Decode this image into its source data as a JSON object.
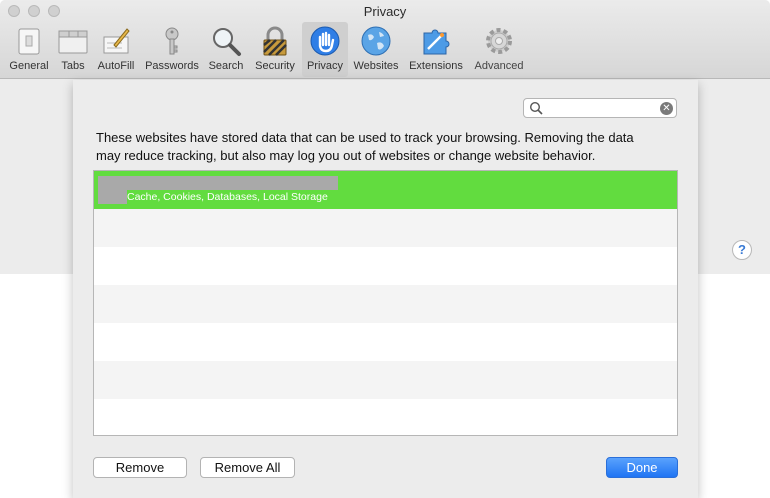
{
  "window": {
    "title": "Privacy"
  },
  "toolbar": {
    "items": [
      {
        "label": "General",
        "icon": "general-icon"
      },
      {
        "label": "Tabs",
        "icon": "tabs-icon"
      },
      {
        "label": "AutoFill",
        "icon": "autofill-icon"
      },
      {
        "label": "Passwords",
        "icon": "key-icon"
      },
      {
        "label": "Search",
        "icon": "search-icon"
      },
      {
        "label": "Security",
        "icon": "padlock-icon"
      },
      {
        "label": "Privacy",
        "icon": "hand-icon",
        "selected": true
      },
      {
        "label": "Websites",
        "icon": "globe-icon"
      },
      {
        "label": "Extensions",
        "icon": "puzzle-icon"
      },
      {
        "label": "Advanced",
        "icon": "gear-icon"
      }
    ]
  },
  "sheet": {
    "search": {
      "value": "",
      "placeholder": ""
    },
    "description_line1": "These websites have stored data that can be used to track your browsing. Removing the data",
    "description_line2": "may reduce tracking, but also may log you out of websites or change website behavior.",
    "selected_row": {
      "detail": "Cache, Cookies, Databases, Local Storage"
    },
    "remove_label": "Remove",
    "remove_all_label": "Remove All",
    "done_label": "Done"
  },
  "help": {
    "label": "?"
  },
  "colors": {
    "selection": "#62dc3f",
    "accent": "#1f74f3"
  }
}
